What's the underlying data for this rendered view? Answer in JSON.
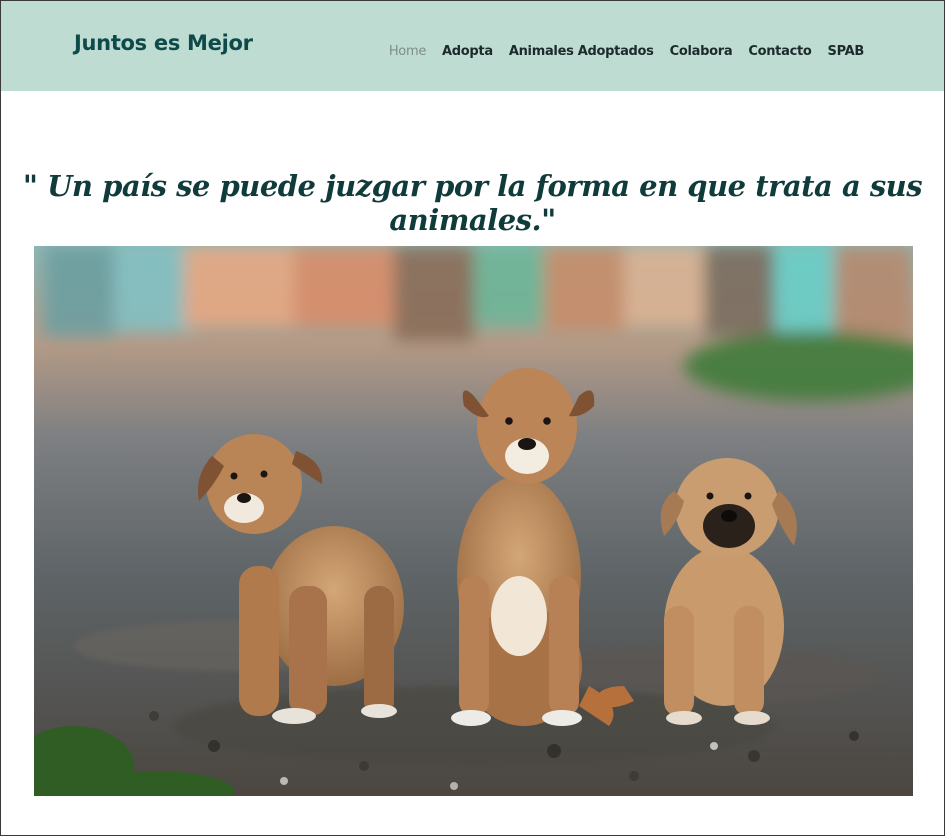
{
  "site": {
    "brand": "Juntos es Mejor"
  },
  "nav": {
    "items": [
      {
        "label": "Home",
        "active": true
      },
      {
        "label": "Adopta",
        "active": false
      },
      {
        "label": "Animales Adoptados",
        "active": false
      },
      {
        "label": "Colabora",
        "active": false
      },
      {
        "label": "Contacto",
        "active": false
      },
      {
        "label": "SPAB",
        "active": false
      }
    ]
  },
  "hero": {
    "quote": "\" Un país se puede juzgar por la forma en que trata a sus animales.\"",
    "image_subject": "three-puppies-photo"
  },
  "colors": {
    "navbar_bg": "#bfdcd2",
    "brand_text": "#0f4a4a",
    "quote_text": "#0f3b3b",
    "active_nav": "#7d8d8a"
  }
}
